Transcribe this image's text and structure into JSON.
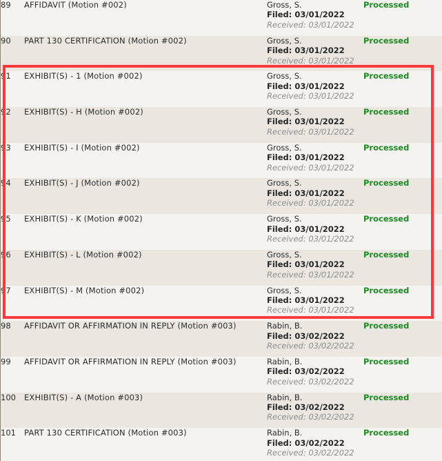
{
  "colors": {
    "highlight_border": "#f93a3a",
    "row_light": "#f5f3ef",
    "row_dark": "#ebe7e0",
    "status_processed": "#1a8a22",
    "received_text": "#8d8d8d"
  },
  "docket": {
    "rows": [
      {
        "seq": "89",
        "document": "AFFIDAVIT  (Motion #002)",
        "party": "Gross, S.",
        "filed": "Filed: 03/01/2022",
        "received": "Received: 03/01/2022",
        "status": "Processed"
      },
      {
        "seq": "90",
        "document": "PART 130 CERTIFICATION  (Motion #002)",
        "party": "Gross, S.",
        "filed": "Filed: 03/01/2022",
        "received": "Received: 03/01/2022",
        "status": "Processed"
      },
      {
        "seq": "91",
        "document": "EXHIBIT(S)  - 1  (Motion #002)",
        "party": "Gross, S.",
        "filed": "Filed: 03/01/2022",
        "received": "Received: 03/01/2022",
        "status": "Processed"
      },
      {
        "seq": "92",
        "document": "EXHIBIT(S)  - H  (Motion #002)",
        "party": "Gross, S.",
        "filed": "Filed: 03/01/2022",
        "received": "Received: 03/01/2022",
        "status": "Processed"
      },
      {
        "seq": "93",
        "document": "EXHIBIT(S)  - I  (Motion #002)",
        "party": "Gross, S.",
        "filed": "Filed: 03/01/2022",
        "received": "Received: 03/01/2022",
        "status": "Processed"
      },
      {
        "seq": "94",
        "document": "EXHIBIT(S)  - J  (Motion #002)",
        "party": "Gross, S.",
        "filed": "Filed: 03/01/2022",
        "received": "Received: 03/01/2022",
        "status": "Processed"
      },
      {
        "seq": "95",
        "document": "EXHIBIT(S)  - K  (Motion #002)",
        "party": "Gross, S.",
        "filed": "Filed: 03/01/2022",
        "received": "Received: 03/01/2022",
        "status": "Processed"
      },
      {
        "seq": "96",
        "document": "EXHIBIT(S)  - L  (Motion #002)",
        "party": "Gross, S.",
        "filed": "Filed: 03/01/2022",
        "received": "Received: 03/01/2022",
        "status": "Processed"
      },
      {
        "seq": "97",
        "document": "EXHIBIT(S)  - M  (Motion #002)",
        "party": "Gross, S.",
        "filed": "Filed: 03/01/2022",
        "received": "Received: 03/01/2022",
        "status": "Processed"
      },
      {
        "seq": "98",
        "document": "AFFIDAVIT OR AFFIRMATION IN REPLY  (Motion #003)",
        "party": "Rabin, B.",
        "filed": "Filed: 03/02/2022",
        "received": "Received: 03/02/2022",
        "status": "Processed"
      },
      {
        "seq": "99",
        "document": "AFFIDAVIT OR AFFIRMATION IN REPLY  (Motion #003)",
        "party": "Rabin, B.",
        "filed": "Filed: 03/02/2022",
        "received": "Received: 03/02/2022",
        "status": "Processed"
      },
      {
        "seq": "100",
        "document": "EXHIBIT(S)  - A  (Motion #003)",
        "party": "Rabin, B.",
        "filed": "Filed: 03/02/2022",
        "received": "Received: 03/02/2022",
        "status": "Processed"
      },
      {
        "seq": "101",
        "document": "PART 130 CERTIFICATION  (Motion #003)",
        "party": "Rabin, B.",
        "filed": "Filed: 03/02/2022",
        "received": "Received: 03/02/2022",
        "status": "Processed"
      }
    ],
    "highlighted_seqs": [
      "91",
      "92",
      "93",
      "94",
      "95",
      "96",
      "97"
    ]
  }
}
